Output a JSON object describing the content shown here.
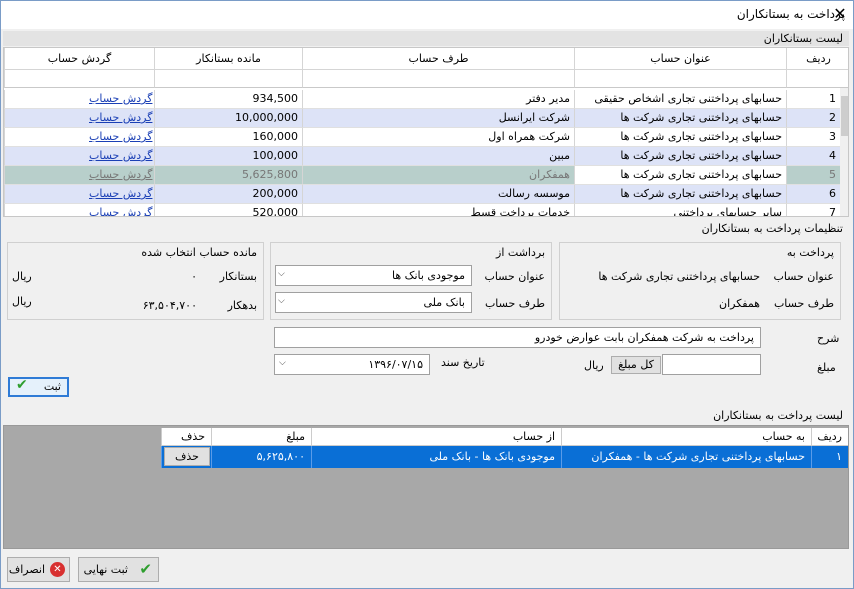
{
  "window": {
    "title": "پرداخت به بستانکاران"
  },
  "creditors": {
    "section_title": "لیست بستانکاران",
    "columns": {
      "row": "ردیف",
      "account_title": "عنوان حساب",
      "party": "طرف حساب",
      "balance": "مانده بستانکار",
      "turnover": "گردش حساب"
    },
    "rows": [
      {
        "n": "1",
        "account": "حسابهای پرداختنی تجاری اشخاص حقیقی",
        "party": "مدیر دفتر",
        "balance": "934,500",
        "link": "گردش حساب"
      },
      {
        "n": "2",
        "account": "حسابهای  پرداختنی تجاری شرکت ها",
        "party": "شرکت ایرانسل",
        "balance": "10,000,000",
        "link": "گردش حساب"
      },
      {
        "n": "3",
        "account": "حسابهای  پرداختنی تجاری شرکت ها",
        "party": "شرکت همراه اول",
        "balance": "160,000",
        "link": "گردش حساب"
      },
      {
        "n": "4",
        "account": "حسابهای  پرداختنی تجاری شرکت ها",
        "party": "مبین",
        "balance": "100,000",
        "link": "گردش حساب"
      },
      {
        "n": "5",
        "account": "حسابهای  پرداختنی تجاری شرکت ها",
        "party": "همفکران",
        "balance": "5,625,800",
        "link": "گردش حساب"
      },
      {
        "n": "6",
        "account": "حسابهای  پرداختنی تجاری شرکت ها",
        "party": "موسسه رسالت",
        "balance": "200,000",
        "link": "گردش حساب"
      },
      {
        "n": "7",
        "account": "سایر حسابهای پرداختنی",
        "party": "خدمات پرداخت قسط",
        "balance": "520,000",
        "link": "گردش حساب"
      }
    ]
  },
  "settings": {
    "section_title": "تنظیمات پرداخت به بستانکاران",
    "pay_to": {
      "title": "پرداخت به",
      "account_label": "عنوان حساب",
      "account_value": "حسابهای  پرداختنی تجاری شرکت ها",
      "party_label": "طرف حساب",
      "party_value": "همفکران"
    },
    "withdraw_from": {
      "title": "برداشت از",
      "account_label": "عنوان حساب",
      "account_value": "موجودی بانک ها",
      "party_label": "طرف حساب",
      "party_value": "بانک ملی"
    },
    "selected_balance": {
      "title": "مانده حساب انتخاب شده",
      "credit_label": "بستانکار",
      "credit_value": "۰",
      "credit_unit": "ریال",
      "debit_label": "بدهکار",
      "debit_value": "۶۳,۵۰۴,۷۰۰",
      "debit_unit": "ریال"
    },
    "description_label": "شرح",
    "description_value": "پرداخت به شرکت همفکران بابت عوارض خودرو",
    "amount_label": "مبلغ",
    "amount_unit": "ریال",
    "full_amount_button": "کل مبلغ",
    "date_label": "تاریخ سند",
    "date_value": "۱۳۹۶/۰۷/۱۵",
    "register_button": "ثبت"
  },
  "payments": {
    "section_title": "لیست پرداخت به بستانکاران",
    "columns": {
      "row": "ردیف",
      "to_account": "به حساب",
      "from_account": "از حساب",
      "amount": "مبلغ",
      "delete": "حذف"
    },
    "rows": [
      {
        "n": "۱",
        "to": "حسابهای  پرداختنی تجاری شرکت ها - همفکران",
        "from": "موجودی بانک ها - بانک ملی",
        "amount": "۵,۶۲۵,۸۰۰",
        "delete": "حذف"
      }
    ]
  },
  "footer": {
    "final_button": "ثبت نهایی",
    "cancel_button": "انصراف"
  },
  "colors": {
    "selected_row": "#0a6fd6",
    "alt_row": "#dde3f7",
    "disabled_row": "#b8cfcb",
    "check_green": "#2e9e2e",
    "cancel_red": "#d83030"
  }
}
